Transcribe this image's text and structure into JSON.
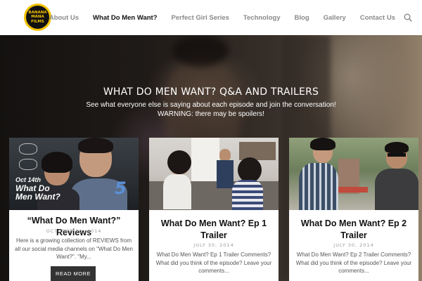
{
  "header": {
    "logo_lines": [
      "BANANA",
      "MANA",
      "FILMS"
    ],
    "nav": [
      {
        "label": "About Us",
        "active": false
      },
      {
        "label": "What Do Men Want?",
        "active": true
      },
      {
        "label": "Perfect Girl Series",
        "active": false
      },
      {
        "label": "Technology",
        "active": false
      },
      {
        "label": "Blog",
        "active": false
      },
      {
        "label": "Gallery",
        "active": false
      },
      {
        "label": "Contact Us",
        "active": false
      }
    ],
    "search_icon": "search-icon"
  },
  "hero": {
    "title": "WHAT DO MEN WANT? Q&A AND TRAILERS",
    "subtitle": "See what everyone else is saying about each episode and join the conversation!",
    "warning": "WARNING: there may be spoilers!"
  },
  "cards": [
    {
      "image_text": [
        "Oct 14th",
        "What Do",
        "Men Want?"
      ],
      "title": "“What Do Men Want?” Reviews",
      "date": "OCTOBER 30, 2014",
      "excerpt": "Here is a growing collection of REVIEWS from all our social media channels on \"What Do Men Want?\". \"My...",
      "button": "READ MORE"
    },
    {
      "title": "What Do Men Want? Ep 1 Trailer",
      "date": "JULY 30, 2014",
      "excerpt": "What Do Men Want? Ep 1 Trailer Comments? What did you think of the episode? Leave your comments..."
    },
    {
      "title": "What Do Men Want? Ep 2 Trailer",
      "date": "JULY 30, 2014",
      "excerpt": "What Do Men Want? Ep 2 Trailer Comments? What did you think of the episode? Leave your comments..."
    }
  ],
  "colors": {
    "accent_logo": "#f2c200",
    "nav_active": "#111111",
    "nav_inactive": "#8a8a8a",
    "button": "#333333"
  }
}
